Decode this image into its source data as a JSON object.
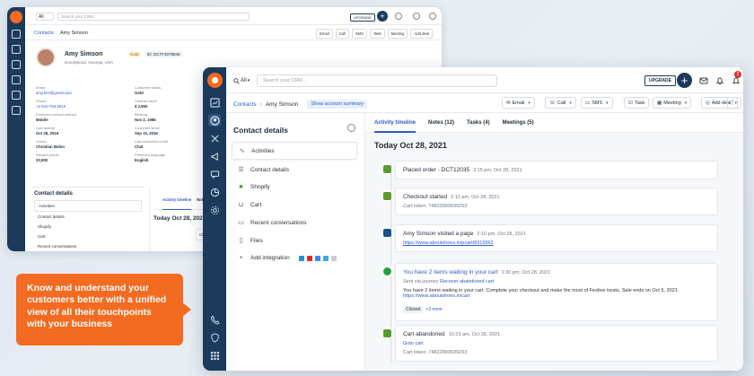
{
  "back": {
    "search_scope": "All",
    "search_placeholder": "Search your CRM...",
    "upgrade": "UPGRADE",
    "notif_count": "2",
    "crumb_root": "Contacts",
    "crumb_name": "Amy Simson",
    "actions": [
      "Email",
      "Call",
      "SMS",
      "Task",
      "Meeting",
      "Add deal"
    ],
    "name": "Amy Simson",
    "tier": "Gold",
    "contact_id": "ID: DCTF3078845",
    "location": "Dundywood, Georgia, USA",
    "fields": [
      {
        "label": "Email",
        "value": "amy.bim@gmail.com",
        "link": true
      },
      {
        "label": "Customer status",
        "value": "Gold"
      },
      {
        "label": "Phone",
        "value": "+1-541-754-3010",
        "link": true
      },
      {
        "label": "Lifetime value",
        "value": "$ 2,950"
      },
      {
        "label": "Preferred contact method",
        "value": "Mobile"
      },
      {
        "label": "Birthday",
        "value": "Nov 2, 1986"
      },
      {
        "label": "Last activity",
        "value": "Oct 28, 2016"
      },
      {
        "label": "Customer since",
        "value": "Sep 10, 2016"
      },
      {
        "label": "Owner",
        "value": "Christian Bohm"
      },
      {
        "label": "Last contacted mode",
        "value": "Chat"
      },
      {
        "label": "Reward points",
        "value": "23,500"
      },
      {
        "label": "Preferred language",
        "value": "English"
      }
    ],
    "cd_title": "Contact details",
    "cd_items": [
      "Activities",
      "Contact details",
      "Shopify",
      "Cart",
      "Recent conversations"
    ],
    "tabs": [
      "Activity timeline",
      "Notes (12)"
    ],
    "date": "Today Oct 28, 2021",
    "events": [
      "Placed order - DC",
      "Checkout started"
    ]
  },
  "front": {
    "search_scope": "All",
    "search_placeholder": "Search your CRM...",
    "upgrade": "UPGRADE",
    "notif_count": "2",
    "crumb_root": "Contacts",
    "crumb_name": "Amy Simson",
    "summary": "Show account summary",
    "actions": {
      "email": "Email",
      "call": "Call",
      "sms": "SMS",
      "task": "Task",
      "meeting": "Meeting",
      "deal": "Add deal"
    },
    "left_title": "Contact details",
    "left_items": {
      "activities": "Activities",
      "details": "Contact details",
      "shopify": "Shopify",
      "cart": "Cart",
      "conv": "Recent conversations",
      "files": "Files",
      "integration": "Add integration"
    },
    "tabs": {
      "timeline": "Activity timeline",
      "notes": "Notes (12)",
      "tasks": "Tasks (4)",
      "meetings": "Meetings (5)"
    },
    "date": "Today Oct 28, 2021",
    "events": {
      "e1": {
        "title": "Placed order - DCT12035",
        "time": "2:15 pm, Oct 28, 2021"
      },
      "e2": {
        "title": "Checkout started",
        "time": "2:12 pm, Oct 28, 2021",
        "sub": "Cart token: 74822899939293"
      },
      "e3": {
        "title": "Amy Simson visited a page",
        "time": "2:10 pm, Oct 28, 2021",
        "link": "https://www.aboutshoes.in/pcart/8315962"
      },
      "e4": {
        "title": "You have 2 items waiting in your cart",
        "time": "1:30 pm, Oct 28, 2021",
        "via": "Sent via journey",
        "via_link": "Recover abandoned cart",
        "body": "You have 2 items waiting in your cart. Complete your checkout and make the most of Festive treats. Sale ends on Oct 5, 2021.",
        "body_link": "https://www.aboutshoes.in/cart",
        "tag": "Clicked",
        "more": "+3 more"
      },
      "e5": {
        "title": "Cart abandoned",
        "time": "10:23 am, Oct 28, 2021",
        "link": "Goto cart",
        "sub": "Cart token: 74822899939293"
      }
    }
  },
  "callout": "Know and understand your customers better with a unified view of all their touchpoints with your business",
  "colors": {
    "brand": "#f26b21",
    "rail": "#1b3a5c",
    "link": "#2c5cc5",
    "shopify": "#5a9a2f",
    "whatsapp": "#25a244"
  }
}
